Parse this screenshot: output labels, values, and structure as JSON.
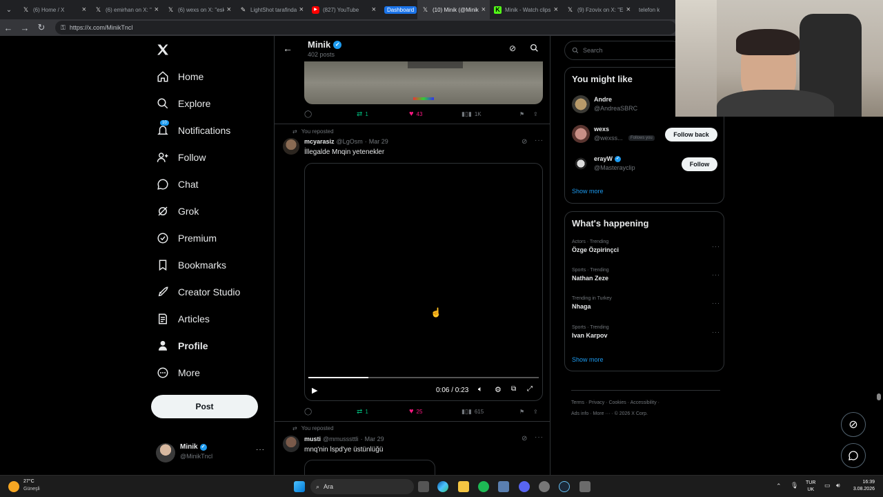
{
  "browser": {
    "tabs": [
      {
        "title": "(6) Home / X",
        "icon": "x-logo"
      },
      {
        "title": "(6) emirhan on X: \"",
        "icon": "x-logo"
      },
      {
        "title": "(6) wexs on X: \"esk",
        "icon": "x-logo"
      },
      {
        "title": "LightShot tarafindan",
        "icon": "feather"
      },
      {
        "title": "(827) YouTube",
        "icon": "youtube"
      },
      {
        "title": "Dashboard",
        "icon": "none"
      },
      {
        "title": "(10) Minik (@Minik",
        "icon": "x-logo"
      },
      {
        "title": "Minik - Watch clips",
        "icon": "kick"
      },
      {
        "title": "(9) Fzovix on X: \"E",
        "icon": "x-logo"
      },
      {
        "title": "telefon k",
        "icon": "none"
      }
    ],
    "url": "https://x.com/MinikTncl"
  },
  "nav": {
    "items": [
      {
        "label": "Home",
        "icon": "home-icon"
      },
      {
        "label": "Explore",
        "icon": "search-icon"
      },
      {
        "label": "Notifications",
        "icon": "bell-icon",
        "badge": "10"
      },
      {
        "label": "Follow",
        "icon": "person-plus-icon"
      },
      {
        "label": "Chat",
        "icon": "chat-icon"
      },
      {
        "label": "Grok",
        "icon": "grok-icon"
      },
      {
        "label": "Premium",
        "icon": "verified-icon"
      },
      {
        "label": "Bookmarks",
        "icon": "bookmark-icon"
      },
      {
        "label": "Creator Studio",
        "icon": "rocket-icon"
      },
      {
        "label": "Articles",
        "icon": "article-icon"
      },
      {
        "label": "Profile",
        "icon": "person-icon"
      },
      {
        "label": "More",
        "icon": "more-circle-icon"
      }
    ],
    "post_label": "Post",
    "account": {
      "name": "Minik",
      "handle": "@MinikTncl"
    }
  },
  "header": {
    "name": "Minik",
    "posts": "402 posts"
  },
  "feed": {
    "prev": {
      "replies": "",
      "reposts": "1",
      "likes": "43",
      "views": "1K"
    },
    "post1": {
      "repost_note": "You reposted",
      "author": "mcyarasiz",
      "handle": "@LgOsm",
      "date": "Mar 29",
      "text": "İllegalde Mnqin yetenekler",
      "video": {
        "time": "0:06 / 0:23",
        "progress": 0.26
      },
      "reposts": "1",
      "likes": "25",
      "views": "615"
    },
    "post2": {
      "repost_note": "You reposted",
      "author": "musti",
      "handle": "@mmusssttli",
      "date": "Mar 29",
      "text": "mnq'nin lspd'ye üstünlüğü"
    }
  },
  "sidebar": {
    "search_placeholder": "Search",
    "might_like": {
      "title": "You might like",
      "users": [
        {
          "name": "Andre",
          "handle": "@AndreaSBRC",
          "button": ""
        },
        {
          "name": "wexs",
          "handle": "@wexss...",
          "follows_you": "Follows you",
          "button": "Follow back"
        },
        {
          "name": "erayW",
          "handle": "@Masterayclip",
          "button": "Follow"
        }
      ],
      "show_more": "Show more"
    },
    "happening": {
      "title": "What's happening",
      "trends": [
        {
          "context": "Actors · Trending",
          "name": "Özge Özpirinçci"
        },
        {
          "context": "Sports · Trending",
          "name": "Nathan Zeze"
        },
        {
          "context": "Trending in Turkey",
          "name": "Nhaga"
        },
        {
          "context": "Sports · Trending",
          "name": "Ivan Karpov"
        }
      ],
      "show_more": "Show more"
    },
    "footer": {
      "line1": "Terms · Privacy · Cookies · Accessibility ·",
      "line2": "Ads info · More ··· · © 2026 X Corp."
    }
  },
  "taskbar": {
    "weather_temp": "27°C",
    "weather_desc": "Güneşli",
    "search": "Ara",
    "lang1": "TUR",
    "lang2": "UK",
    "time": "16:39",
    "date": "3.08.2026"
  },
  "colors": {
    "accent": "#1d9bf0",
    "like": "#f91880",
    "repost": "#00ba7c",
    "bg": "#000000",
    "border": "#2f3336"
  }
}
